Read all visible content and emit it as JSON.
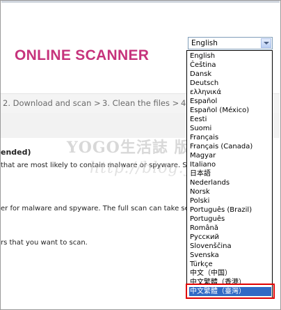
{
  "brand": {
    "title": "ONLINE SCANNER"
  },
  "steps": [
    {
      "label": "2. Download and scan >"
    },
    {
      "label": "3. Clean the files >"
    },
    {
      "label": "4"
    }
  ],
  "content": {
    "heading": "ended)",
    "line1": "that are most likely to contain malware or spyware. Sc",
    "line2": "er for malware and spyware. The full scan can take se",
    "line3": "rs that you want to scan."
  },
  "watermark": {
    "line1": "YOGO生活誌 版權所有",
    "line2": "http://blog.yogo.tw"
  },
  "language_select": {
    "value": "English",
    "options": [
      "English",
      "Čeština",
      "Dansk",
      "Deutsch",
      "ελληνικά",
      "Español",
      "Español (México)",
      "Eesti",
      "Suomi",
      "Français",
      "Français (Canada)",
      "Magyar",
      "Italiano",
      "日本語",
      "Nederlands",
      "Norsk",
      "Polski",
      "Português (Brazil)",
      "Português",
      "Română",
      "Русский",
      "Slovenščina",
      "Svenska",
      "Türkçe",
      "中文（中国）",
      "中文繁體（香港）",
      "中文繁體（臺灣）"
    ],
    "selected_option": "中文繁體（臺灣）"
  }
}
